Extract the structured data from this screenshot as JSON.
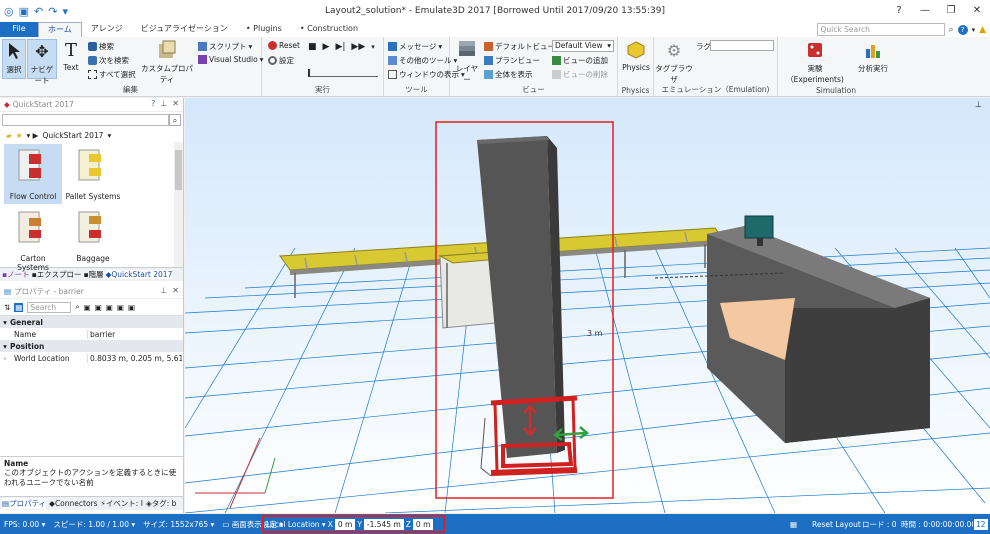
{
  "window": {
    "title": "Layout2_solution* - Emulate3D 2017 [Borrowed Until 2017/09/20 13:55:39]"
  },
  "tabs": [
    {
      "label": "File"
    },
    {
      "label": "ホーム"
    },
    {
      "label": "アレンジ"
    },
    {
      "label": "ビジュアライゼーション"
    },
    {
      "label": "Plugins"
    },
    {
      "label": "Construction"
    }
  ],
  "quick_search": {
    "placeholder": "Quick Search"
  },
  "ribbon": {
    "edit": {
      "select": "選択",
      "navigate": "ナビゲート",
      "text": "Text",
      "search": "検索",
      "find_next": "次を検索",
      "select_all": "すべて選択",
      "custom_property": "カスタムプロパティ",
      "script": "スクリプト",
      "visual_studio": "Visual Studio",
      "label": "編集"
    },
    "run": {
      "reset": "Reset",
      "settings": "設定",
      "label": "実行"
    },
    "tools": {
      "messages": "メッセージ",
      "other_tools": "その他のツール",
      "window_display": "ウィンドウの表示",
      "label": "ツール"
    },
    "view": {
      "layers": "レイヤー",
      "default_view": "デフォルトビュー",
      "plan_view": "プランビュー",
      "show_all": "全体を表示",
      "view_select": "Default View",
      "add_view": "ビューの追加",
      "delete_view": "ビューの削除",
      "label": "ビュー"
    },
    "physics": {
      "physics": "Physics",
      "label": "Physics"
    },
    "emulation": {
      "tag_browser": "タグブラウザ",
      "lag": "ラグ",
      "label": "エミュレーション（Emulation)"
    },
    "simulation": {
      "experiments": "実験（Experiments)",
      "analysis": "分析実行",
      "label": "Simulation"
    }
  },
  "quickstart": {
    "title": "QuickStart 2017",
    "breadcrumb": "QuickStart 2017",
    "items": [
      {
        "label": "Flow Control"
      },
      {
        "label": "Pallet Systems"
      },
      {
        "label": "Carton Systems"
      },
      {
        "label": "Baggage"
      }
    ]
  },
  "pane_tabs": [
    {
      "label": "ノート"
    },
    {
      "label": "エクスプロー"
    },
    {
      "label": "階層"
    },
    {
      "label": "QuickStart 2017"
    }
  ],
  "properties": {
    "title": "プロパティ - barrier",
    "search_placeholder": "Search",
    "sections": [
      {
        "name": "General",
        "rows": [
          {
            "key": "Name",
            "value": "barrier"
          }
        ]
      },
      {
        "name": "Position",
        "rows": [
          {
            "key": "World Location",
            "value": "0.8033 m, 0.205 m, 5.6138 m"
          }
        ]
      }
    ],
    "desc_title": "Name",
    "desc_text": "このオブジェクトのアクションを定義するときに使われるユニークでない名前"
  },
  "bottom_tabs": [
    {
      "label": "プロパティ"
    },
    {
      "label": "Connectors"
    },
    {
      "label": "イベント: I"
    },
    {
      "label": "タグ: b"
    }
  ],
  "status": {
    "fps": "FPS: 0.00",
    "speed": "スピード: 1.00 / 1.00",
    "size": "サイズ: 1552x765",
    "display_settings": "画面表示設定",
    "local_location": "Local Location",
    "x_label": "X",
    "x_value": "0 m",
    "y_label": "Y",
    "y_value": "-1.545 m",
    "z_label": "Z",
    "z_value": "0 m",
    "reset_layout": "Reset Layout",
    "load": "ロード : 0",
    "time": "時間 : 0:00:00:00.00",
    "badge": "12"
  },
  "viewport": {
    "dimension_label": "3 m"
  },
  "colors": {
    "accent": "#1c6fc2",
    "highlight": "#e02020",
    "conveyor": "#d8c832"
  }
}
